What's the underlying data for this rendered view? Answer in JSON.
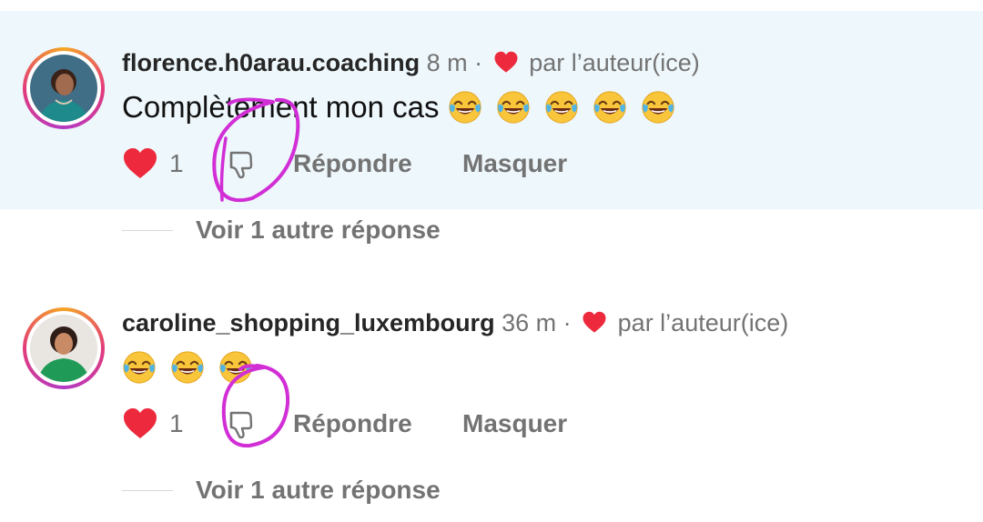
{
  "comments": [
    {
      "username": "florence.h0arau.coaching",
      "time": "8 m",
      "separator": "·",
      "liked_by_author": "par l’auteur(ice)",
      "text": "Complètement mon cas",
      "emojis": [
        "face-with-tears-of-joy",
        "face-with-tears-of-joy",
        "face-with-tears-of-joy",
        "face-with-tears-of-joy",
        "face-with-tears-of-joy"
      ],
      "like_count": "1",
      "reply_label": "Répondre",
      "hide_label": "Masquer",
      "view_replies": "Voir 1 autre réponse"
    },
    {
      "username": "caroline_shopping_luxembourg",
      "time": "36 m",
      "separator": "·",
      "liked_by_author": "par l’auteur(ice)",
      "text": "",
      "emojis": [
        "face-with-tears-of-joy",
        "face-with-tears-of-joy",
        "face-with-tears-of-joy"
      ],
      "like_count": "1",
      "reply_label": "Répondre",
      "hide_label": "Masquer",
      "view_replies": "Voir 1 autre réponse"
    }
  ],
  "colors": {
    "highlight_bg": "#eef7fb",
    "like_red": "#ed2a3d",
    "annotation_magenta": "#d12ed6",
    "meta_gray": "#737373"
  },
  "icons": {
    "like": "heart-icon",
    "dislike": "thumbs-down-icon",
    "emoji": "face-with-tears-of-joy"
  }
}
